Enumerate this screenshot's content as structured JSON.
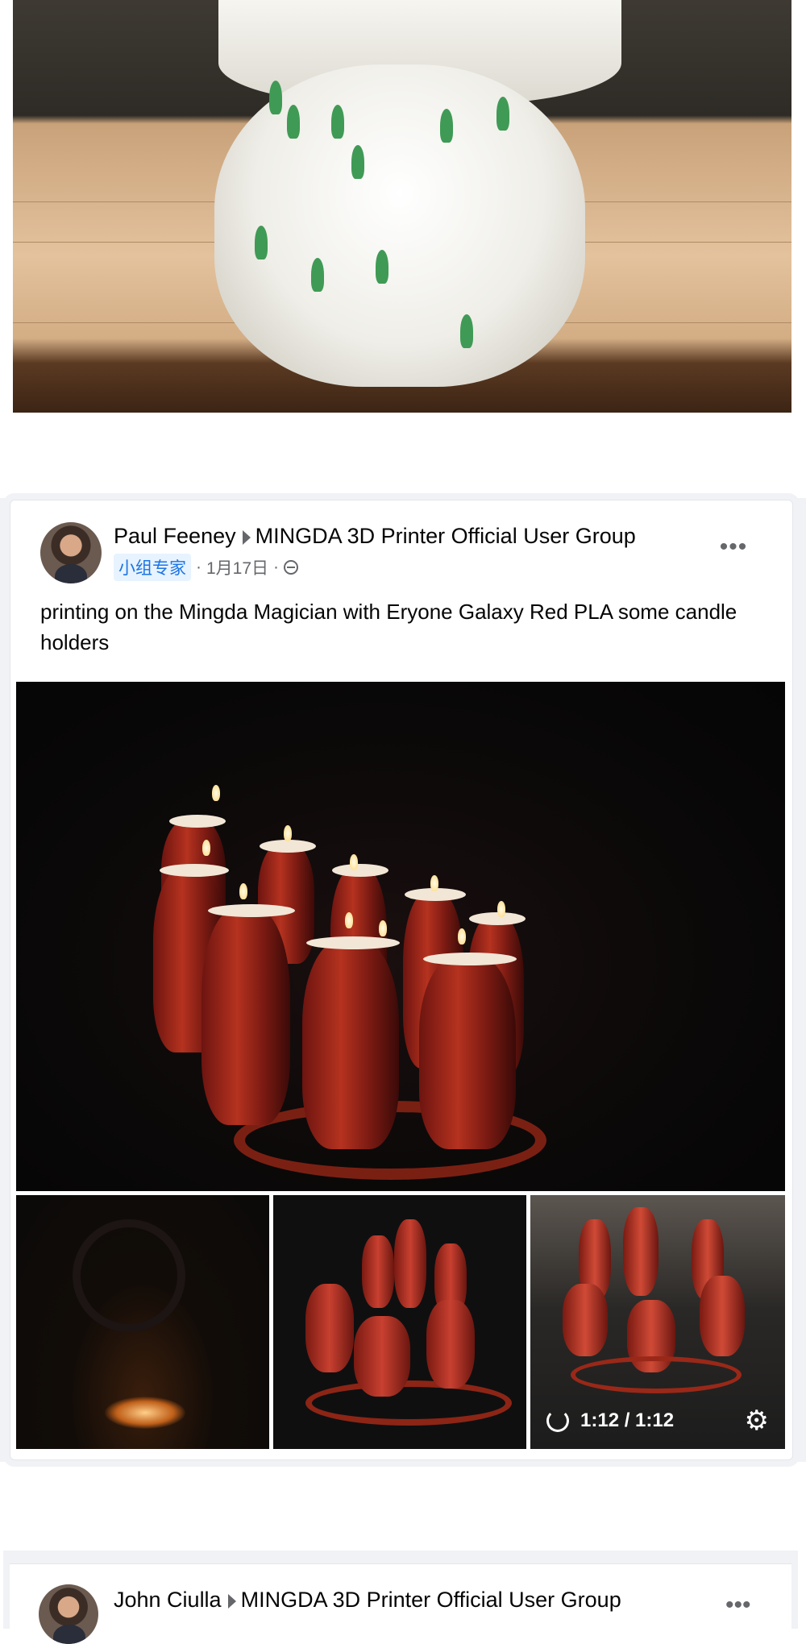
{
  "post": {
    "author": "Paul Feeney",
    "group": "MINGDA 3D Printer Official User Group",
    "badge": "小组专家",
    "date": "1月17日",
    "separator": "·",
    "text": "printing on the Mingda Magician with Eryone Galaxy Red PLA some candle holders",
    "more_label": "•••",
    "video": {
      "time": "1:12 / 1:12"
    }
  },
  "next_post": {
    "author": "John Ciulla",
    "group": "MINGDA 3D Printer Official User Group",
    "more_label": "•••"
  },
  "icons": {
    "privacy": "globe-icon",
    "arrow": "caret-right-icon",
    "replay": "replay-icon",
    "settings": "gear-icon"
  },
  "colors": {
    "page_bg": "#f0f2f5",
    "badge_bg": "#e7f3ff",
    "badge_text": "#1b74e4",
    "meta_text": "#65676b"
  }
}
